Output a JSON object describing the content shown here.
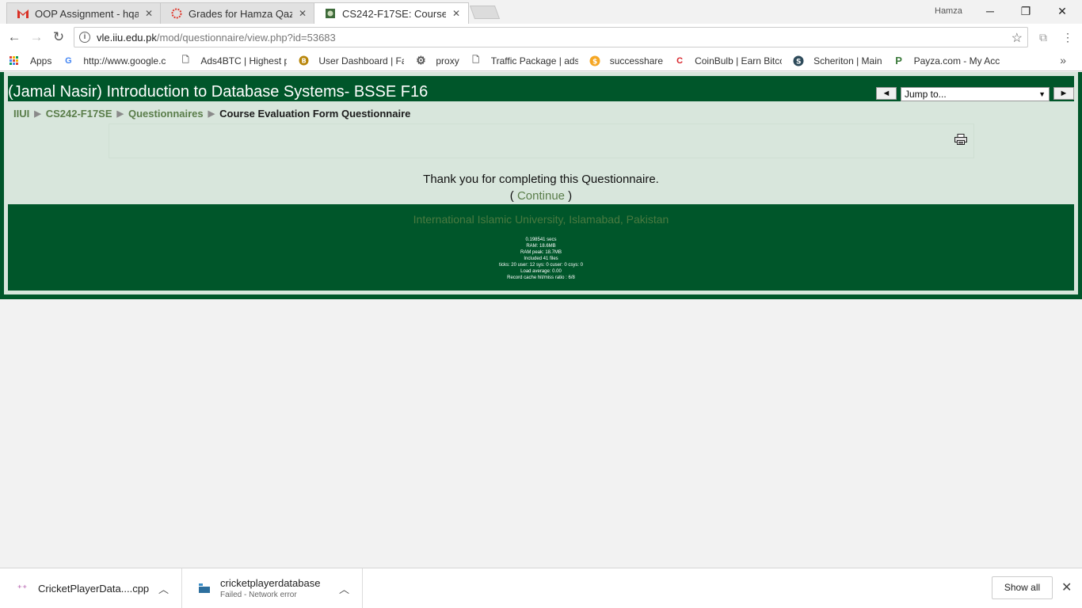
{
  "browser": {
    "tabs": [
      {
        "title": "OOP Assignment - hqazi(",
        "icon": "gmail-icon",
        "active": false
      },
      {
        "title": "Grades for Hamza Qazi: Ir",
        "icon": "canvas-icon",
        "active": false
      },
      {
        "title": "CS242-F17SE: Course Eva",
        "icon": "moodle-icon",
        "active": true
      }
    ],
    "profile_name": "Hamza",
    "url_host": "vle.iiu.edu.pk",
    "url_path": "/mod/questionnaire/view.php?id=53683",
    "bookmarks": [
      {
        "label": "Apps",
        "icon": "apps-grid-icon"
      },
      {
        "label": "http://www.google.c",
        "icon": "google-icon"
      },
      {
        "label": "Ads4BTC | Highest p",
        "icon": "page-icon"
      },
      {
        "label": "User Dashboard | Fa",
        "icon": "coin-icon"
      },
      {
        "label": "proxy",
        "icon": "gear-icon"
      },
      {
        "label": "Traffic Package | adsc",
        "icon": "page-icon"
      },
      {
        "label": "successhare",
        "icon": "dollar-coin-icon"
      },
      {
        "label": "CoinBulb | Earn Bitco",
        "icon": "coinbulb-icon"
      },
      {
        "label": "Scheriton | Main",
        "icon": "scheriton-icon"
      },
      {
        "label": "Payza.com - My Acc",
        "icon": "payza-icon"
      }
    ],
    "bookmarks_more": "»"
  },
  "page": {
    "course_title": "(Jamal Nasir) Introduction to Database Systems- BSSE F16",
    "jump_to": "Jump to...",
    "jump_prev": "◄",
    "jump_next": "►",
    "breadcrumb": [
      "IIUI",
      "CS242-F17SE",
      "Questionnaires",
      "Course Evaluation Form Questionnaire"
    ],
    "breadcrumb_sep": "▶",
    "thanks_message": "Thank you for completing this Questionnaire.",
    "continue_open": "( ",
    "continue_label": "Continue",
    "continue_close": " )",
    "footer_university": "International Islamic University, Islamabad, Pakistan",
    "footer_stats": [
      "0.198541 secs",
      "RAM: 18.6MB",
      "RAM peak: 18.7MB",
      "Included 41 files",
      "ticks: 20 user: 12 sys: 0 cuser: 0 csys: 0",
      "Load average: 0.00",
      "Record cache hit/miss ratio : 6/8"
    ]
  },
  "downloads": {
    "items": [
      {
        "name": "CricketPlayerData....cpp",
        "status": ""
      },
      {
        "name": "cricketplayerdatabase",
        "status": "Failed - Network error"
      }
    ],
    "show_all": "Show all"
  },
  "colors": {
    "theme_dark_green": "#00562a",
    "theme_light_green": "#d8e6dc",
    "link_green": "#5a7d4a"
  }
}
